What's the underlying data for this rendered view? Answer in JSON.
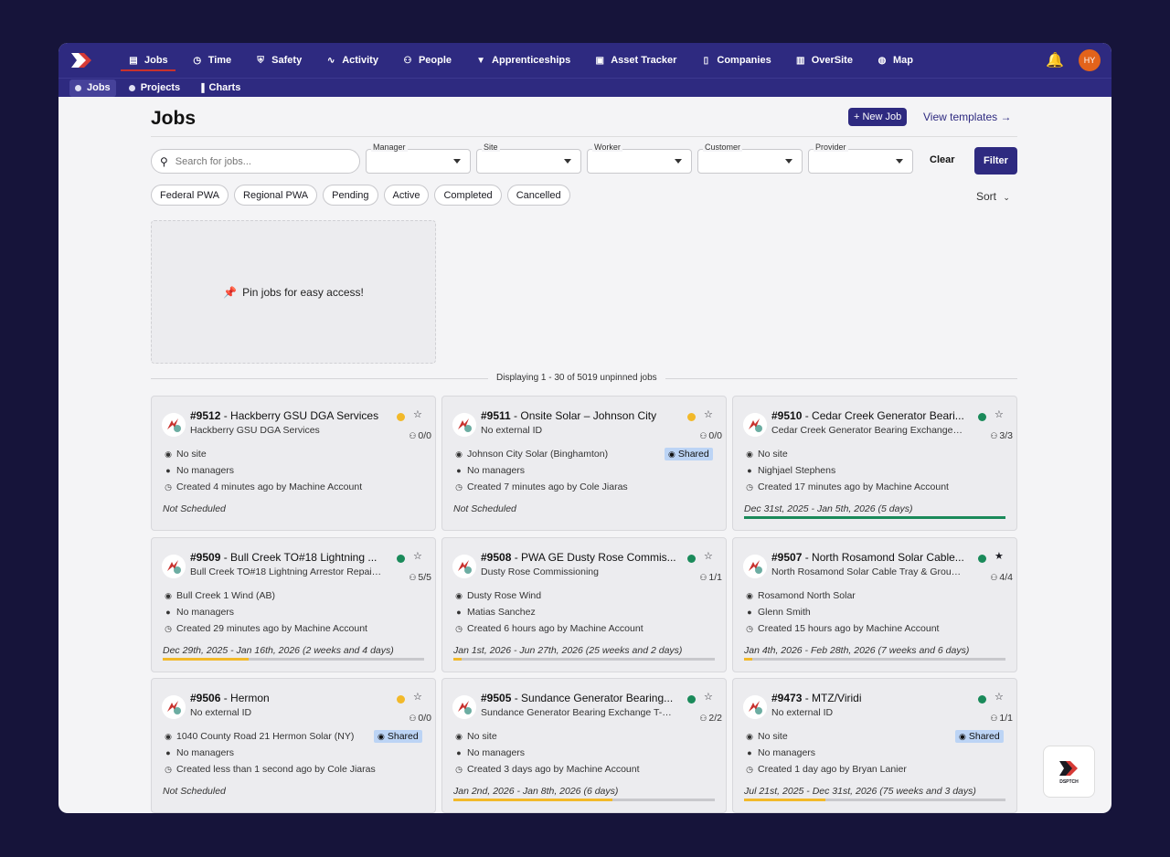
{
  "nav": {
    "items": [
      {
        "label": "Jobs",
        "icon": "briefcase-icon",
        "glyph": "▤"
      },
      {
        "label": "Time",
        "icon": "clock-icon",
        "glyph": "◷"
      },
      {
        "label": "Safety",
        "icon": "shield-icon",
        "glyph": "⛨"
      },
      {
        "label": "Activity",
        "icon": "activity-icon",
        "glyph": "∿"
      },
      {
        "label": "People",
        "icon": "people-icon",
        "glyph": "⚇"
      },
      {
        "label": "Apprenticeships",
        "icon": "graduation-cap-icon",
        "glyph": "▼"
      },
      {
        "label": "Asset Tracker",
        "icon": "camera-icon",
        "glyph": "▣"
      },
      {
        "label": "Companies",
        "icon": "building-icon",
        "glyph": "▯"
      },
      {
        "label": "OverSite",
        "icon": "map-fold-icon",
        "glyph": "▥"
      },
      {
        "label": "Map",
        "icon": "globe-icon",
        "glyph": "◍"
      }
    ],
    "avatar_initials": "HY"
  },
  "subnav": {
    "tabs": [
      {
        "label": "Jobs",
        "icon": "dot-icon"
      },
      {
        "label": "Projects",
        "icon": "dot-icon"
      },
      {
        "label": "Charts",
        "icon": "bar-chart-icon"
      }
    ]
  },
  "page": {
    "title": "Jobs",
    "new_job_label": "+ New Job",
    "view_templates_label": "View templates →"
  },
  "filters": {
    "search_placeholder": "Search for jobs...",
    "selects": [
      {
        "label": "Manager"
      },
      {
        "label": "Site"
      },
      {
        "label": "Worker"
      },
      {
        "label": "Customer"
      },
      {
        "label": "Provider"
      }
    ],
    "clear_label": "Clear",
    "filter_label": "Filter",
    "chips": [
      "Federal PWA",
      "Regional PWA",
      "Pending",
      "Active",
      "Completed",
      "Cancelled"
    ],
    "sort_label": "Sort"
  },
  "pin_area": {
    "text": "Pin jobs for easy access!"
  },
  "display_text": "Displaying 1 - 30 of 5019 unpinned jobs",
  "colors": {
    "accent": "#2e2a80",
    "green": "#1a8a5a",
    "yellow": "#f2b92a",
    "shared_bg": "#bcd4f5"
  },
  "jobs": [
    {
      "number": "#9512",
      "title": " - Hackberry GSU DGA Services",
      "sub": "Hackberry GSU DGA Services",
      "status": "yellow",
      "count": "0/0",
      "site": "No site",
      "managers": "No managers",
      "created": "Created 4 minutes ago by Machine Account",
      "shared": "",
      "schedule": "Not Scheduled",
      "scheduled": false,
      "progress": 0,
      "pinned": false
    },
    {
      "number": "#9511",
      "title": " - Onsite Solar – Johnson City",
      "sub": "No external ID",
      "status": "yellow",
      "count": "0/0",
      "site": "Johnson City Solar (Binghamton)",
      "managers": "No managers",
      "created": "Created 7 minutes ago by Cole Jiaras",
      "shared": "Shared",
      "schedule": "Not Scheduled",
      "scheduled": false,
      "progress": 0,
      "pinned": false
    },
    {
      "number": "#9510",
      "title": " - Cedar Creek Generator Beari...",
      "sub": "Cedar Creek Generator Bearing Exchange ...",
      "status": "green",
      "count": "3/3",
      "site": "No site",
      "managers": "Nighjael Stephens",
      "created": "Created 17 minutes ago by Machine Account",
      "shared": "",
      "schedule": "Dec 31st, 2025 - Jan 5th, 2026 (5 days)",
      "scheduled": true,
      "progress": 1.0,
      "progress_color": "green",
      "pinned": false
    },
    {
      "number": "#9509",
      "title": " - Bull Creek TO#18 Lightning ...",
      "sub": "Bull Creek TO#18 Lightning Arrestor Repair...",
      "status": "green",
      "count": "5/5",
      "site": "Bull Creek 1 Wind (AB)",
      "managers": "No managers",
      "created": "Created 29 minutes ago by Machine Account",
      "shared": "",
      "schedule": "Dec 29th, 2025 - Jan 16th, 2026 (2 weeks and 4 days)",
      "scheduled": true,
      "progress": 0.33,
      "progress_color": "yellow",
      "pinned": false
    },
    {
      "number": "#9508",
      "title": " - PWA GE Dusty Rose Commis...",
      "sub": "Dusty Rose Commissioning",
      "status": "green",
      "count": "1/1",
      "site": "Dusty Rose Wind",
      "managers": "Matias Sanchez",
      "created": "Created 6 hours ago by Machine Account",
      "shared": "",
      "schedule": "Jan 1st, 2026 - Jun 27th, 2026 (25 weeks and 2 days)",
      "scheduled": true,
      "progress": 0.03,
      "progress_color": "yellow",
      "pinned": false
    },
    {
      "number": "#9507",
      "title": " - North Rosamond Solar Cable...",
      "sub": "North Rosamond Solar Cable Tray & Groun...",
      "status": "green",
      "count": "4/4",
      "site": "Rosamond North Solar",
      "managers": "Glenn Smith",
      "created": "Created 15 hours ago by Machine Account",
      "shared": "",
      "schedule": "Jan 4th, 2026 - Feb 28th, 2026 (7 weeks and 6 days)",
      "scheduled": true,
      "progress": 0.03,
      "progress_color": "yellow",
      "pinned": true
    },
    {
      "number": "#9506",
      "title": " - Hermon",
      "sub": "No external ID",
      "status": "yellow",
      "count": "0/0",
      "site": "1040 County Road 21 Hermon Solar (NY)",
      "managers": "No managers",
      "created": "Created less than 1 second ago by Cole Jiaras",
      "shared": "Shared",
      "schedule": "Not Scheduled",
      "scheduled": false,
      "progress": 0,
      "pinned": false
    },
    {
      "number": "#9505",
      "title": " - Sundance Generator Bearing...",
      "sub": "Sundance Generator Bearing Exchange T-6...",
      "status": "green",
      "count": "2/2",
      "site": "No site",
      "managers": "No managers",
      "created": "Created 3 days ago by Machine Account",
      "shared": "",
      "schedule": "Jan 2nd, 2026 - Jan 8th, 2026 (6 days)",
      "scheduled": true,
      "progress": 0.61,
      "progress_color": "yellow",
      "pinned": false
    },
    {
      "number": "#9473",
      "title": " - MTZ/Viridi",
      "sub": "No external ID",
      "status": "green",
      "count": "1/1",
      "site": "No site",
      "managers": "No managers",
      "created": "Created 1 day ago by Bryan Lanier",
      "shared": "Shared",
      "schedule": "Jul 21st, 2025 - Dec 31st, 2026 (75 weeks and 3 days)",
      "scheduled": true,
      "progress": 0.31,
      "progress_color": "yellow",
      "pinned": false
    }
  ],
  "brand_badge": "DSPTCH"
}
